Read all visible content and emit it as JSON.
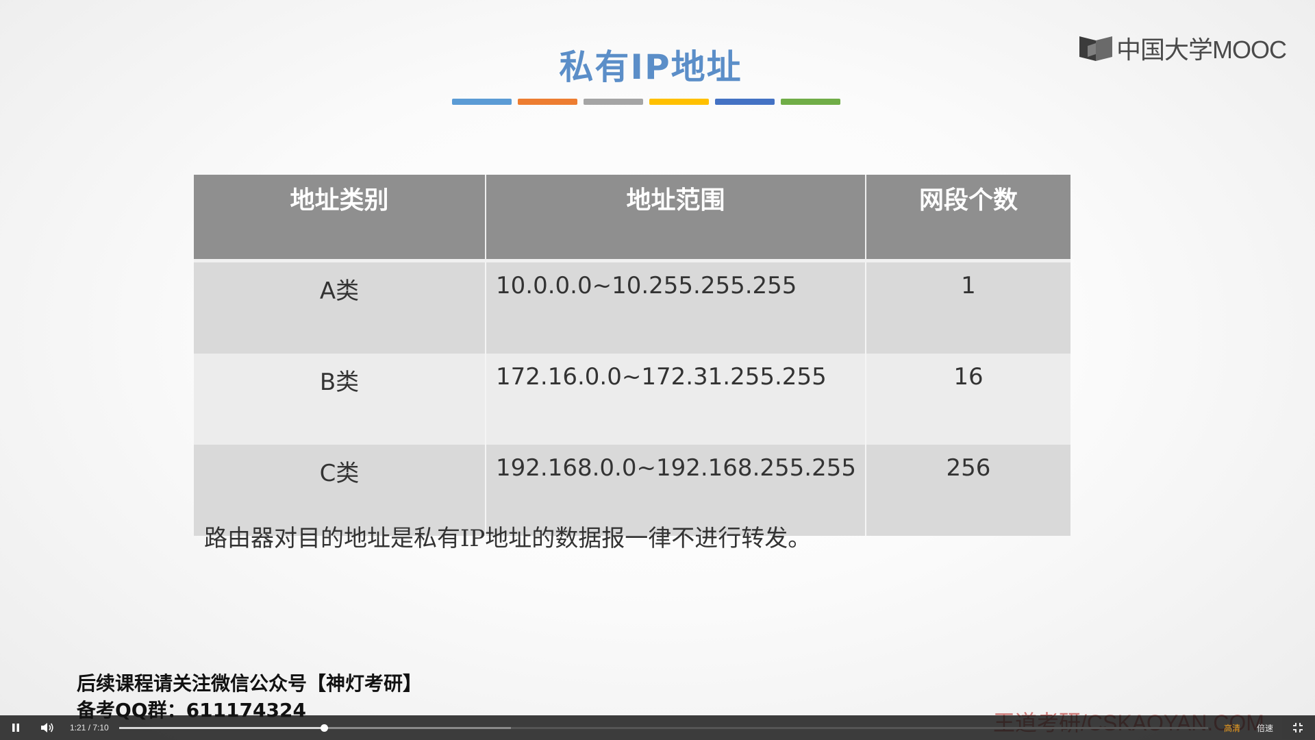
{
  "slide": {
    "title": "私有IP地址",
    "color_bars": [
      "#5b9bd5",
      "#ed7d31",
      "#a5a5a5",
      "#ffc000",
      "#4472c4",
      "#70ad47"
    ],
    "logo_text": "中国大学MOOC",
    "table": {
      "headers": [
        "地址类别",
        "地址范围",
        "网段个数"
      ],
      "rows": [
        {
          "class": "A类",
          "range": "10.0.0.0~10.255.255.255",
          "count": "1"
        },
        {
          "class": "B类",
          "range": "172.16.0.0~172.31.255.255",
          "count": "16"
        },
        {
          "class": "C类",
          "range": "192.168.0.0~192.168.255.255",
          "count": "256"
        }
      ]
    },
    "note": "路由器对目的地址是私有IP地址的数据报一律不进行转发。"
  },
  "overlay": {
    "promo_line1": "后续课程请关注微信公众号【神灯考研】",
    "promo_line2": "备考QQ群：611174324",
    "watermark": "王道考研/CSKAOYAN.COM"
  },
  "player": {
    "time_current": "1:21",
    "time_separator": " / ",
    "time_total": "7:10",
    "progress_fraction": 0.188,
    "buffered_fraction": 0.36,
    "quality_label": "高清",
    "speed_label": "倍速",
    "icons": {
      "play_pause": "pause-icon",
      "volume": "volume-icon",
      "fullscreen": "exit-fullscreen-icon"
    }
  }
}
